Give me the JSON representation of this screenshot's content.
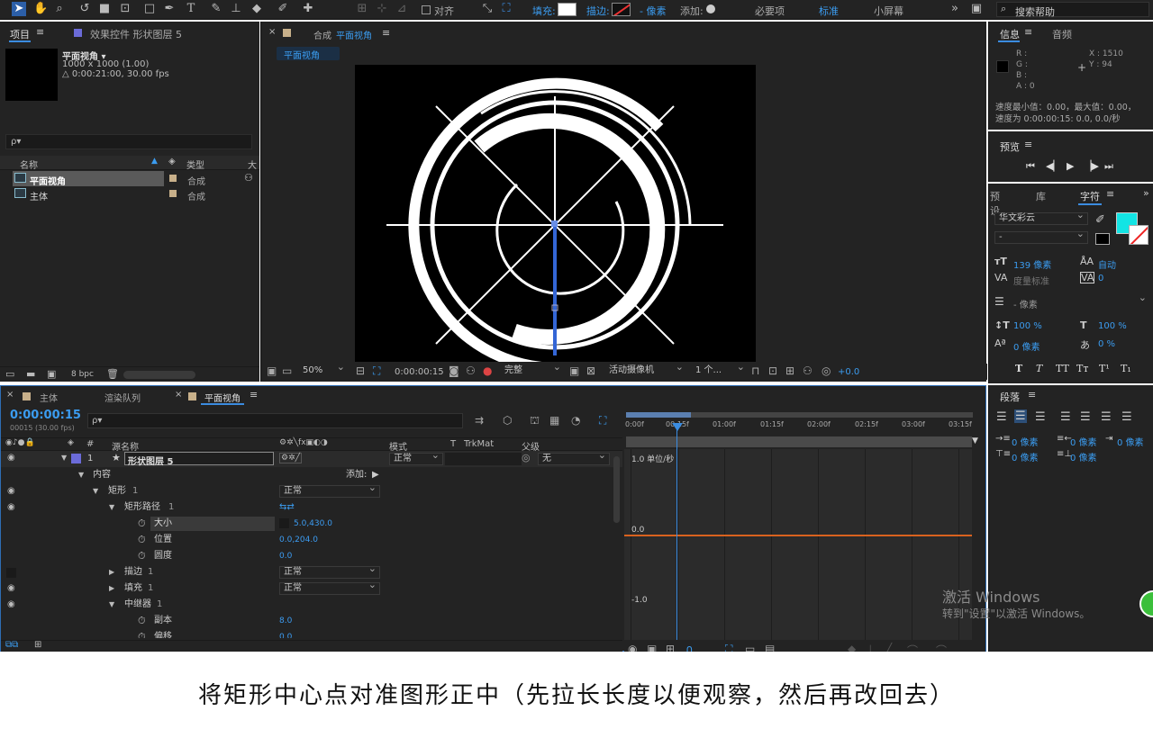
{
  "toolbar": {
    "snap_label": "对齐",
    "fill_label": "填充:",
    "stroke_label": "描边:",
    "stroke_units": "- 像素",
    "add_label": "添加:",
    "workspaces": [
      "必要项",
      "标准",
      "小屏幕"
    ],
    "active_workspace": "标准",
    "search_placeholder": "搜索帮助"
  },
  "project": {
    "tab": "项目",
    "tab2": "效果控件 形状图层 5",
    "item_name": "平面视角 ▾",
    "item_size": "1000 x 1000 (1.00)",
    "item_duration": "△ 0:00:21:00, 30.00 fps",
    "search_icon": "ρ▾",
    "col_name": "名称",
    "col_type": "类型",
    "col_size": "大",
    "items": [
      {
        "name": "平面视角",
        "type": "合成"
      },
      {
        "name": "主体",
        "type": "合成"
      }
    ],
    "bpc": "8 bpc"
  },
  "composition": {
    "tab_prefix": "合成",
    "tab_name": "平面视角",
    "flow_tab": "平面视角",
    "zoom": "50%",
    "time": "0:00:00:15",
    "resolution": "完整",
    "camera": "活动摄像机",
    "views": "1 个...",
    "exposure": "+0.0"
  },
  "info": {
    "tab": "信息",
    "tab2": "音频",
    "r": "R :",
    "g": "G :",
    "b": "B :",
    "a": "A : 0",
    "x": "X : 1510",
    "y": "Y : 94",
    "speed_line1": "速度最小值：0.00，最大值：0.00，",
    "speed_line2": "速度为 0:00:00:15: 0.0, 0.0/秒",
    "preview": "预览"
  },
  "character": {
    "tab_presets": "预设",
    "tab_library": "库",
    "tab_char": "字符",
    "font": "华文彩云",
    "style": "-",
    "size": "139 像素",
    "leading": "自动",
    "kerning": "度量标准",
    "tracking": "0",
    "stroke": "- 像素",
    "vscale": "100 %",
    "hscale": "100 %",
    "baseline": "0 像素",
    "tsume": "0 %",
    "fill_color": "#13e4e4"
  },
  "paragraph": {
    "tab": "段落",
    "v1": "0 像素",
    "v2": "0 像素",
    "v3": "0 像素",
    "v4": "0 像素",
    "v5": "0 像素"
  },
  "timeline": {
    "tab_main": "主体",
    "tab_render": "渲染队列",
    "tab_comp": "平面视角",
    "timecode": "0:00:00:15",
    "timecode_sub": "00015 (30.00 fps)",
    "col_num": "#",
    "col_source": "源名称",
    "col_mode": "模式",
    "col_t": "T",
    "col_trkmat": "TrkMat",
    "col_parent": "父级",
    "layer_num": "1",
    "layer_name": "形状图层 5",
    "layer_mode": "正常",
    "layer_parent": "无",
    "contents": "内容",
    "add": "添加:",
    "props": [
      {
        "label": "矩形",
        "idx": "1",
        "value": "正常"
      },
      {
        "label": "矩形路径",
        "idx": "1"
      },
      {
        "label": "大小",
        "value": "5.0,430.0"
      },
      {
        "label": "位置",
        "value": "0.0,204.0"
      },
      {
        "label": "圆度",
        "value": "0.0"
      },
      {
        "label": "描边",
        "idx": "1",
        "value": "正常"
      },
      {
        "label": "填充",
        "idx": "1",
        "value": "正常"
      },
      {
        "label": "中继器",
        "idx": "1"
      },
      {
        "label": "副本",
        "value": "8.0"
      },
      {
        "label": "偏移",
        "value": "0.0"
      }
    ],
    "ruler": [
      "0:00f",
      "00:15f",
      "01:00f",
      "01:15f",
      "02:00f",
      "02:15f",
      "03:00f",
      "03:15f"
    ],
    "graph_top": "1.0 单位/秒",
    "graph_mid": "0.0",
    "graph_bot": "-1.0"
  },
  "watermark": {
    "line1": "激活 Windows",
    "line2": "转到\"设置\"以激活 Windows。"
  },
  "caption": "将矩形中心点对准图形正中（先拉长长度以便观察，然后再改回去）"
}
